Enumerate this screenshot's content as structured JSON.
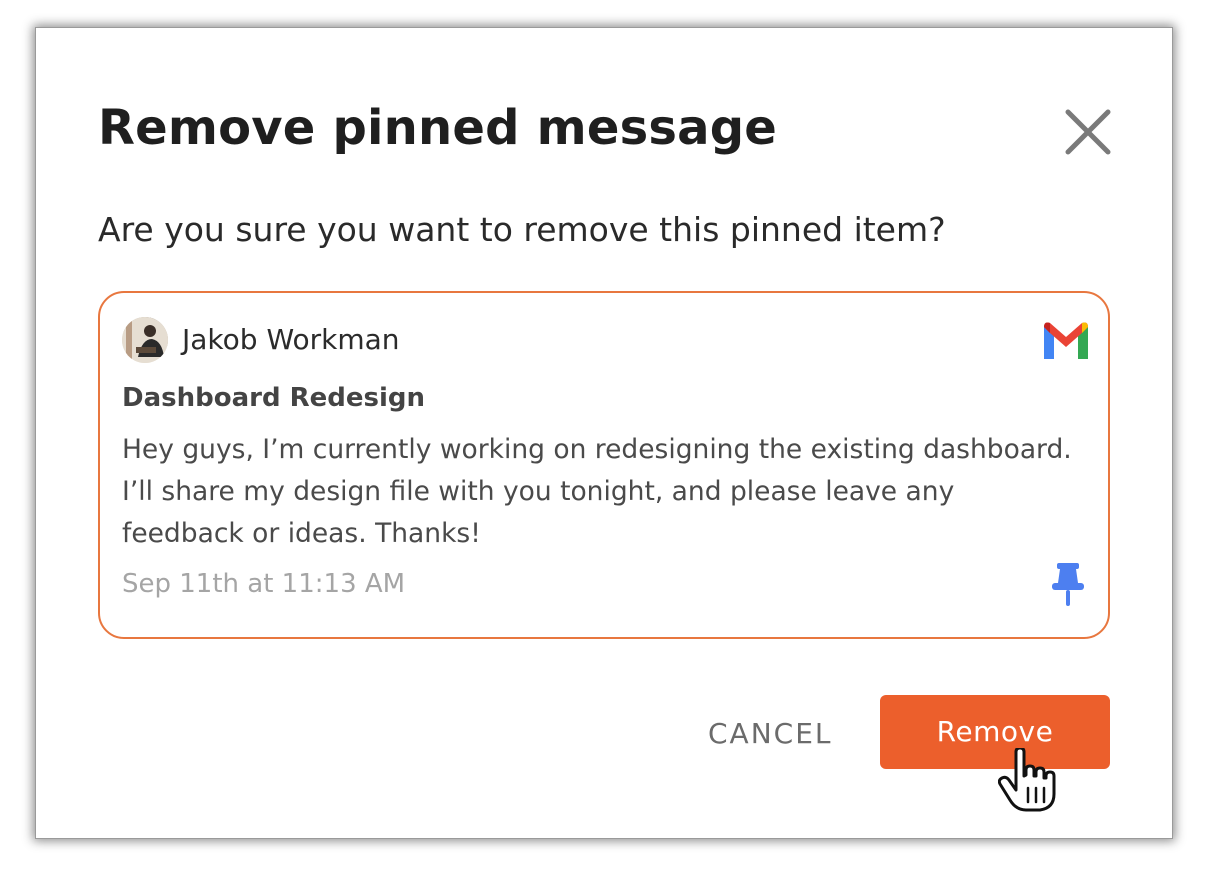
{
  "dialog": {
    "title": "Remove pinned message",
    "question": "Are you sure you want to remove this pinned item?",
    "close_icon": "close-icon"
  },
  "message": {
    "author": "Jakob Workman",
    "source_icon": "gmail-icon",
    "subject": "Dashboard Redesign",
    "body": "Hey guys, I’m currently working on redesigning the existing dashboard. I’ll share my design file with you tonight, and please leave any feedback or ideas. Thanks!",
    "timestamp": "Sep 11th at 11:13 AM",
    "pin_icon": "pin-icon"
  },
  "actions": {
    "cancel_label": "CANCEL",
    "remove_label": "Remove"
  },
  "colors": {
    "accent": "#ec5f2c",
    "card_border": "#e8773f",
    "pin": "#4d7ff0"
  }
}
